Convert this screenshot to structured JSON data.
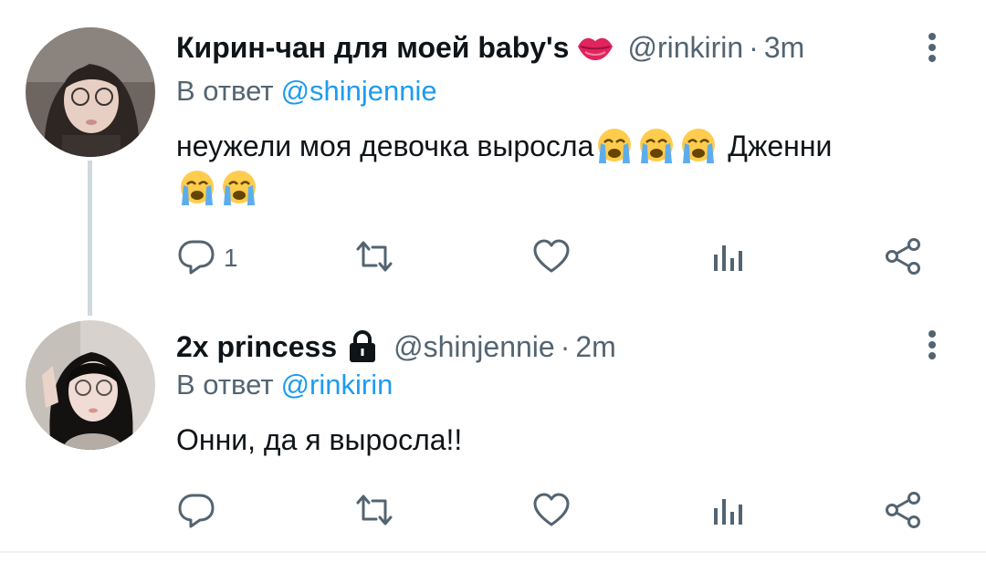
{
  "tweets": [
    {
      "display_name": "Кирин-чан для моей baby's",
      "name_badge": "lips-emoji",
      "handle": "@rinkirin",
      "separator": "·",
      "time": "3m",
      "reply_label": "В ответ",
      "reply_mention": "@shinjennie",
      "text_part1": "неужели моя девочка выросла",
      "text_part2": "Дженни",
      "emoji": "loudly-crying-face",
      "reply_count": "1"
    },
    {
      "display_name": "2x princess",
      "name_badge": "lock-icon",
      "handle": "@shinjennie",
      "separator": "·",
      "time": "2m",
      "reply_label": "В ответ",
      "reply_mention": "@rinkirin",
      "text": "Онни, да я выросла!!",
      "reply_count": ""
    }
  ],
  "icons": [
    "reply-icon",
    "retweet-icon",
    "like-icon",
    "analytics-icon",
    "share-icon",
    "more-icon"
  ],
  "colors": {
    "text": "#0f1419",
    "secondary": "#536471",
    "link": "#1d9bf0",
    "thread_line": "#cfd9de"
  }
}
